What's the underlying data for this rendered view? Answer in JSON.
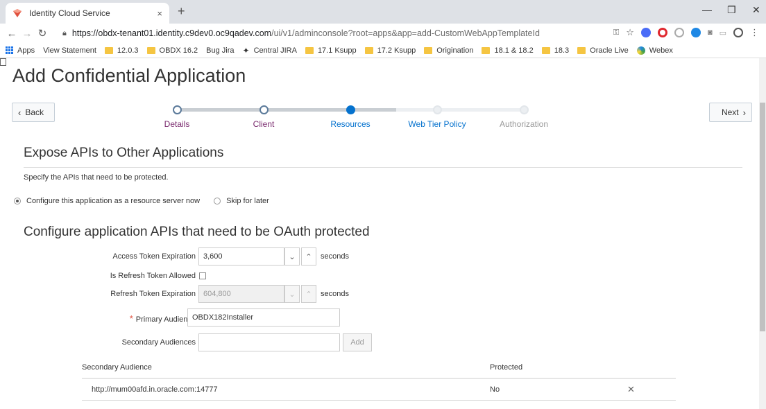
{
  "browser": {
    "tab_title": "Identity Cloud Service",
    "tab_close": "×",
    "new_tab": "+",
    "url_host": "https://obdx-tenant01.identity.c9dev0.oc9qadev.com",
    "url_path": "/ui/v1/adminconsole?root=apps&app=add-CustomWebAppTemplateId",
    "bookmarks": [
      {
        "icon": "apps-grid-icon",
        "label": "Apps"
      },
      {
        "icon": "page-icon",
        "label": "View Statement"
      },
      {
        "icon": "folder-icon",
        "label": "12.0.3"
      },
      {
        "icon": "folder-icon",
        "label": "OBDX 16.2"
      },
      {
        "icon": "page-icon",
        "label": "Bug Jira"
      },
      {
        "icon": "jira-icon",
        "label": "Central JIRA"
      },
      {
        "icon": "folder-icon",
        "label": "17.1 Ksupp"
      },
      {
        "icon": "folder-icon",
        "label": "17.2 Ksupp"
      },
      {
        "icon": "folder-icon",
        "label": "Origination"
      },
      {
        "icon": "folder-icon",
        "label": "18.1 & 18.2"
      },
      {
        "icon": "folder-icon",
        "label": "18.3"
      },
      {
        "icon": "folder-icon",
        "label": "Oracle Live"
      },
      {
        "icon": "webex-icon",
        "label": "Webex"
      }
    ]
  },
  "page": {
    "title": "Add Confidential Application",
    "back_label": "Back",
    "next_label": "Next",
    "steps": [
      {
        "label": "Details",
        "state": "done"
      },
      {
        "label": "Client",
        "state": "done"
      },
      {
        "label": "Resources",
        "state": "current"
      },
      {
        "label": "Web Tier Policy",
        "state": "todo"
      },
      {
        "label": "Authorization",
        "state": "disabled"
      }
    ],
    "section1_title": "Expose APIs to Other Applications",
    "section1_desc": "Specify the APIs that need to be protected.",
    "radio_now": "Configure this application as a resource server now",
    "radio_skip": "Skip for later",
    "section2_title": "Configure application APIs that need to be OAuth protected",
    "form": {
      "access_token_label": "Access Token Expiration",
      "access_token_value": "3,600",
      "seconds": "seconds",
      "refresh_allowed_label": "Is Refresh Token Allowed",
      "refresh_token_label": "Refresh Token Expiration",
      "refresh_token_value": "604,800",
      "required_mark": "*",
      "primary_audience_label": "Primary Audience",
      "primary_audience_value": "OBDX182Installer",
      "secondary_audiences_label": "Secondary Audiences",
      "secondary_audiences_value": "",
      "add_label": "Add"
    },
    "table": {
      "col_audience": "Secondary Audience",
      "col_protected": "Protected",
      "rows": [
        {
          "audience": "http://mum00afd.in.oracle.com:14777",
          "protected": "No"
        }
      ]
    }
  },
  "colors": {
    "accent": "#0572ce",
    "step_done_label": "#7a2a6e",
    "step_current_label": "#0572ce"
  }
}
